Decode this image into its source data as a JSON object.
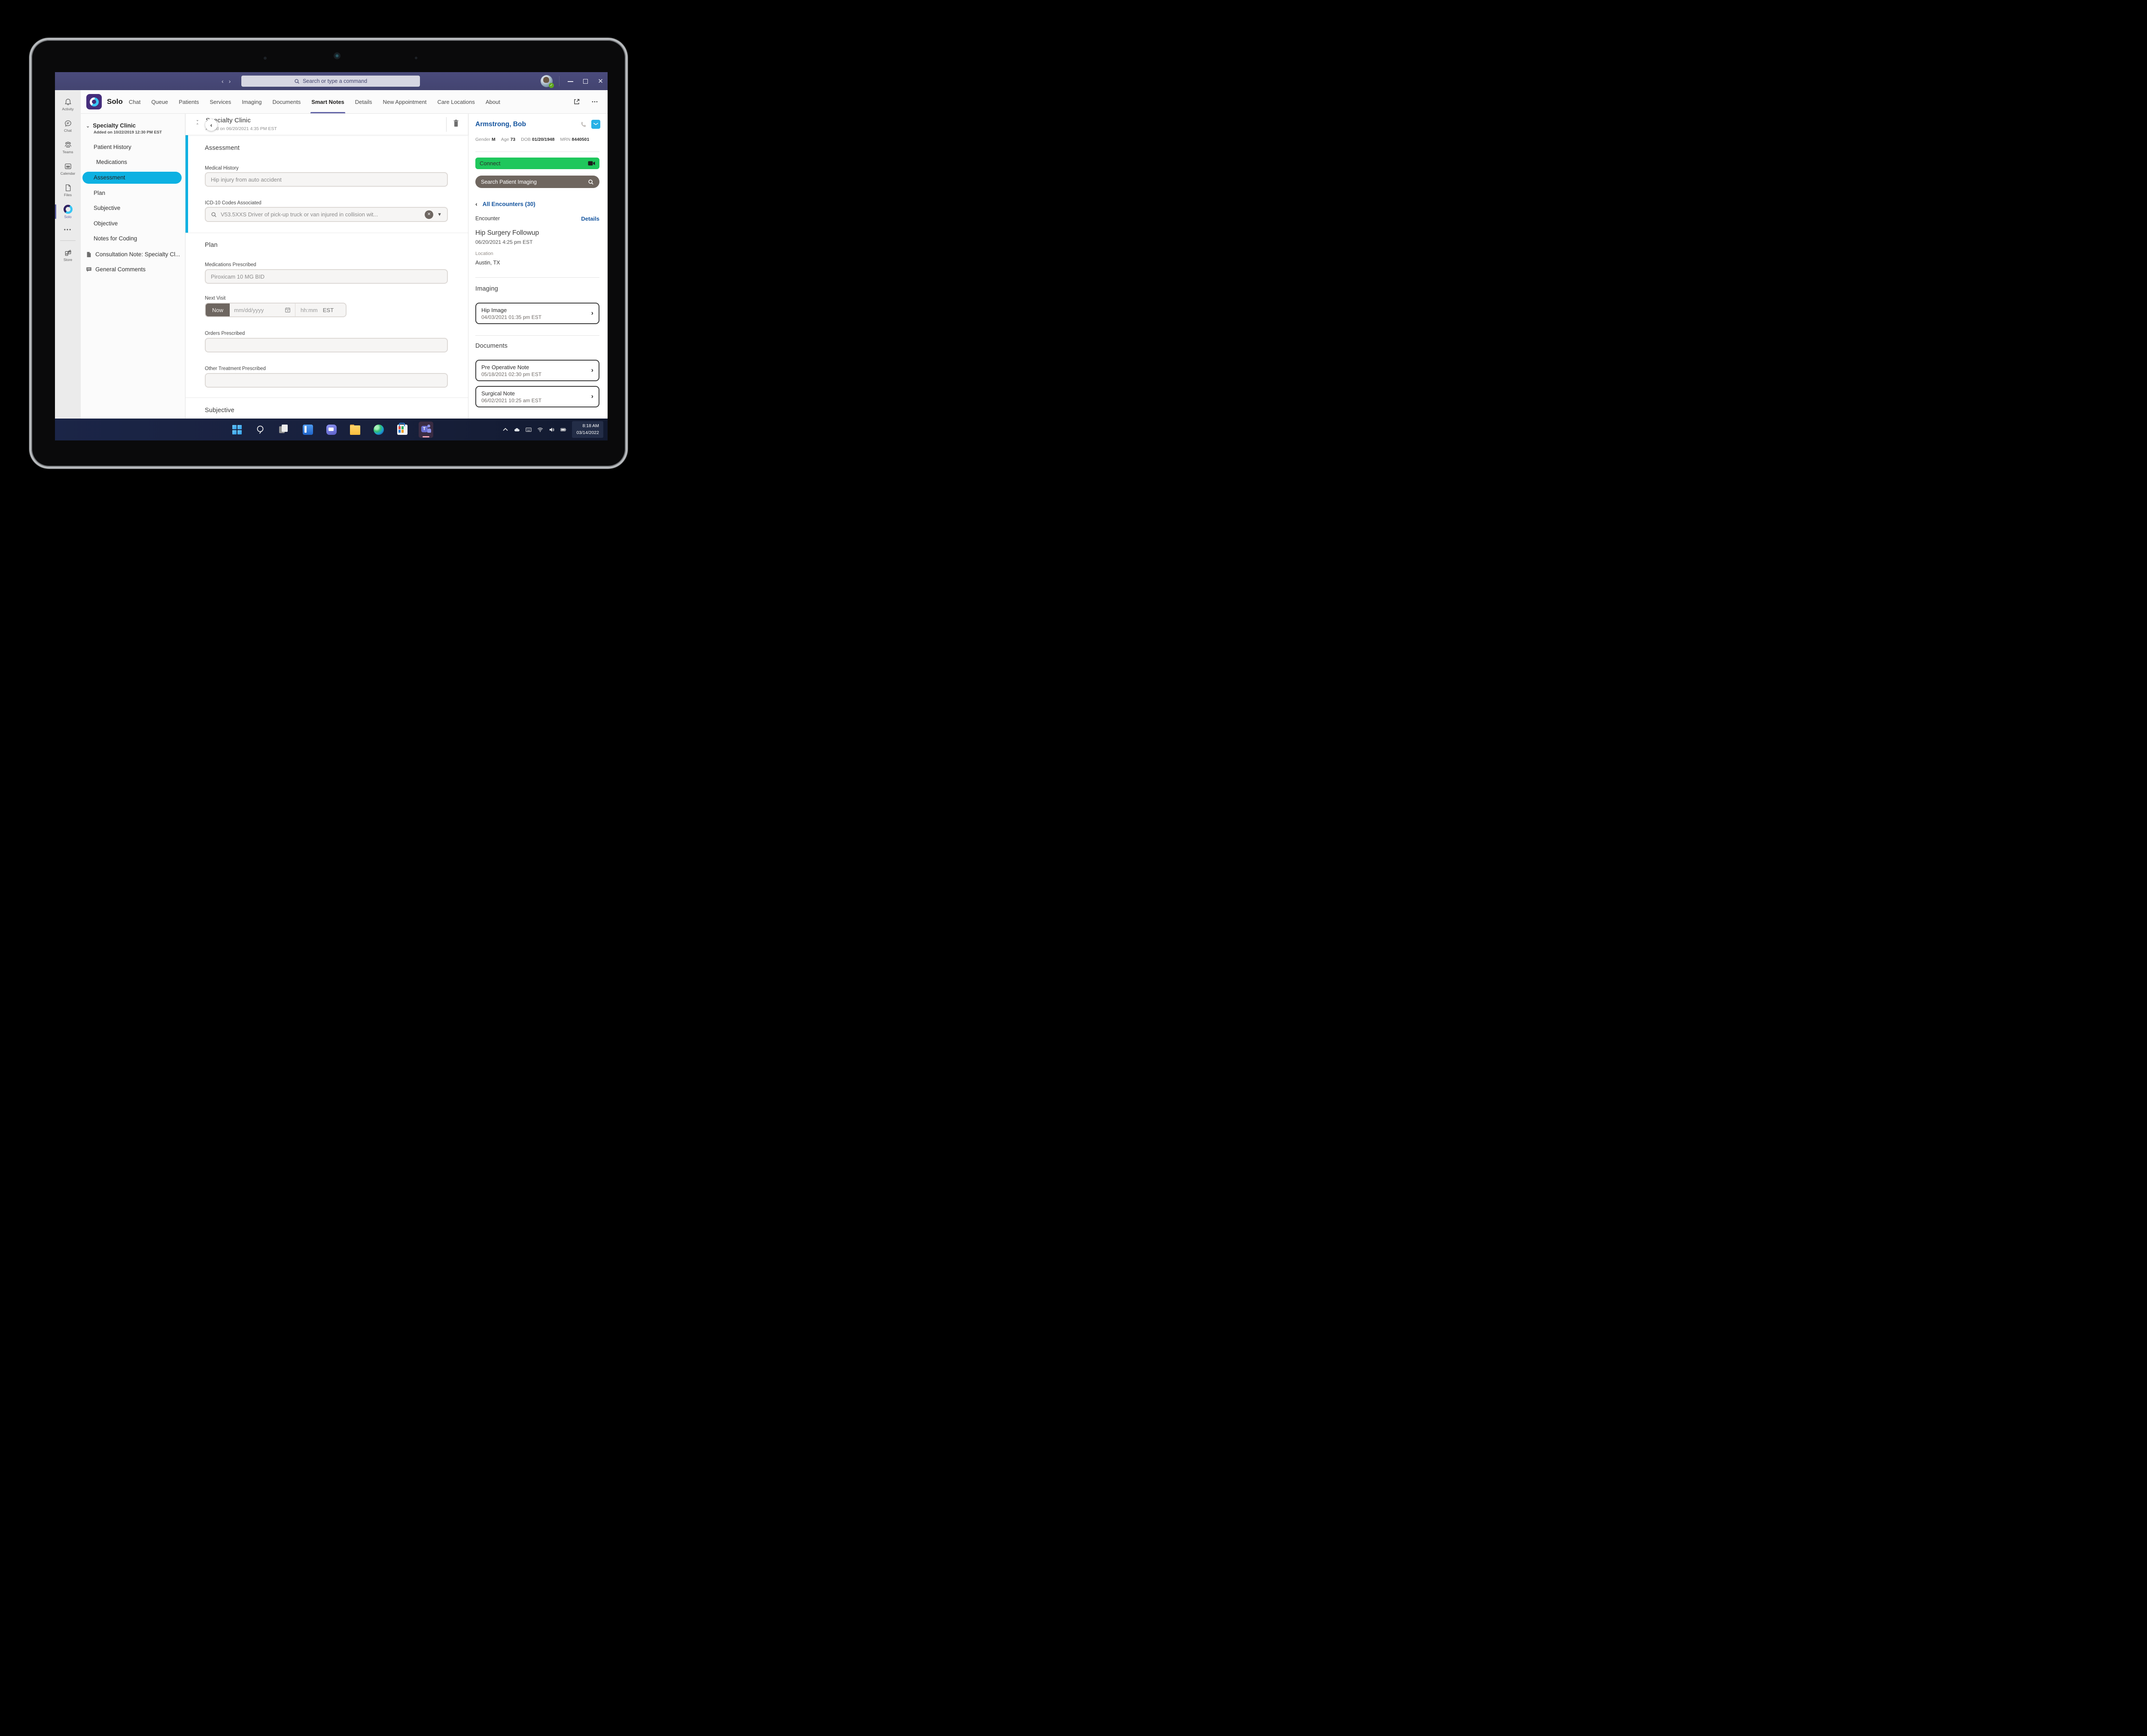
{
  "titlebar": {
    "search_placeholder": "Search or type a command"
  },
  "rail": {
    "items": [
      {
        "label": "Activity"
      },
      {
        "label": "Chat"
      },
      {
        "label": "Teams"
      },
      {
        "label": "Calendar"
      },
      {
        "label": "Files"
      },
      {
        "label": "Solo"
      },
      {
        "label": "Store"
      }
    ]
  },
  "app_header": {
    "app_name": "Solo",
    "tabs": [
      {
        "label": "Chat"
      },
      {
        "label": "Queue"
      },
      {
        "label": "Patients"
      },
      {
        "label": "Services"
      },
      {
        "label": "Imaging"
      },
      {
        "label": "Documents"
      },
      {
        "label": "Smart Notes"
      },
      {
        "label": "Details"
      },
      {
        "label": "New Appointment"
      },
      {
        "label": "Care Locations"
      },
      {
        "label": "About"
      }
    ],
    "active_tab": "Smart Notes"
  },
  "notes_panel": {
    "note_title": "Specialty Clinic",
    "note_added": "Added on 10/22/2019 12:30 PM EST",
    "items": [
      {
        "label": "Patient History"
      },
      {
        "label": "Medications"
      },
      {
        "label": "Assessment"
      },
      {
        "label": "Plan"
      },
      {
        "label": "Subjective"
      },
      {
        "label": "Objective"
      },
      {
        "label": "Notes for Coding"
      }
    ],
    "active_item": "Assessment",
    "documents": [
      {
        "label": "Consultation Note: Specialty Cl..."
      },
      {
        "label": "General Comments"
      }
    ]
  },
  "editor": {
    "title": "Specialty Clinic",
    "added": "Added on 06/20/2021 4:35 PM EST",
    "assessment_heading": "Assessment",
    "medical_history_label": "Medical History",
    "medical_history_value": "Hip injury from auto accident",
    "icd_label": "ICD-10 Codes Associated",
    "icd_value": "V53.5XXS Driver of pick-up truck or van injured in collision wit...",
    "plan_heading": "Plan",
    "medications_label": "Medications Prescribed",
    "medications_value": "Piroxicam 10 MG BID",
    "next_visit_label": "Next Visit",
    "now_label": "Now",
    "date_placeholder": "mm/dd/yyyy",
    "time_placeholder": "hh:mm",
    "timezone": "EST",
    "orders_label": "Orders Prescribed",
    "orders_value": "",
    "other_treatment_label": "Other Treatment Prescribed",
    "other_treatment_value": "",
    "subjective_heading": "Subjective"
  },
  "patient_panel": {
    "name": "Armstrong, Bob",
    "gender_label": "Gender",
    "gender": "M",
    "age_label": "Age",
    "age": "73",
    "dob_label": "DOB",
    "dob": "01/20/1948",
    "mrn_label": "MRN",
    "mrn": "8440501",
    "connect_label": "Connect",
    "imaging_search_label": "Search Patient Imaging",
    "encounters_link": "All Encounters (30)",
    "encounter_label": "Encounter",
    "details_label": "Details",
    "encounter_title": "Hip Surgery Followup",
    "encounter_time": "06/20/2021 4:25 pm EST",
    "location_label": "Location",
    "location_value": "Austin, TX",
    "imaging_heading": "Imaging",
    "imaging_items": [
      {
        "title": "Hip Image",
        "time": "04/03/2021 01:35 pm EST"
      }
    ],
    "documents_heading": "Documents",
    "document_items": [
      {
        "title": "Pre Operative Note",
        "time": "05/18/2021 02:30 pm EST"
      },
      {
        "title": "Surgical Note",
        "time": "06/02/2021 10:25 am EST"
      }
    ]
  },
  "taskbar": {
    "time": "8:18 AM",
    "date": "03/14/2022"
  },
  "colors": {
    "teams_purple": "#464775",
    "accent_cyan": "#0db1e2",
    "connect_green": "#1fc75c",
    "link_blue": "#14549e",
    "imaging_search_bg": "#6f665f"
  }
}
